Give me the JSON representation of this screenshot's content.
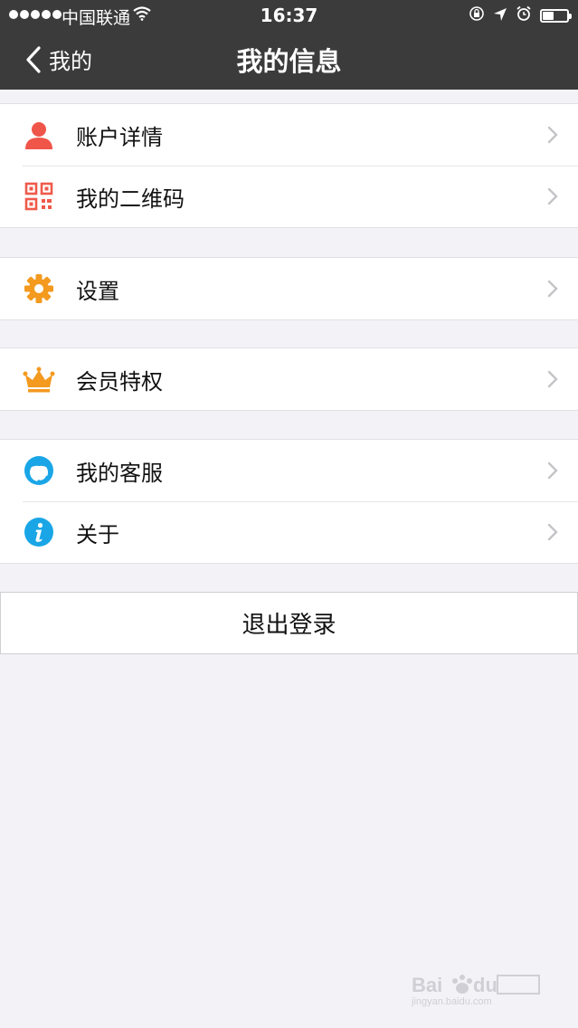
{
  "status_bar": {
    "carrier": "中国联通",
    "time": "16:37",
    "battery_level": 0.45
  },
  "nav": {
    "back_label": "我的",
    "title": "我的信息"
  },
  "groups": [
    {
      "items": [
        {
          "label": "账户详情",
          "icon": "user-icon",
          "color": "#f0554a"
        },
        {
          "label": "我的二维码",
          "icon": "qr-code-icon",
          "color": "#ef5a4a"
        }
      ]
    },
    {
      "items": [
        {
          "label": "设置",
          "icon": "gear-icon",
          "color": "#f39a1f"
        }
      ]
    },
    {
      "items": [
        {
          "label": "会员特权",
          "icon": "crown-icon",
          "color": "#f39a1f"
        }
      ]
    },
    {
      "items": [
        {
          "label": "我的客服",
          "icon": "customer-service-icon",
          "color": "#1aa6e6"
        },
        {
          "label": "关于",
          "icon": "info-icon",
          "color": "#1aa6e6"
        }
      ]
    }
  ],
  "logout_label": "退出登录"
}
